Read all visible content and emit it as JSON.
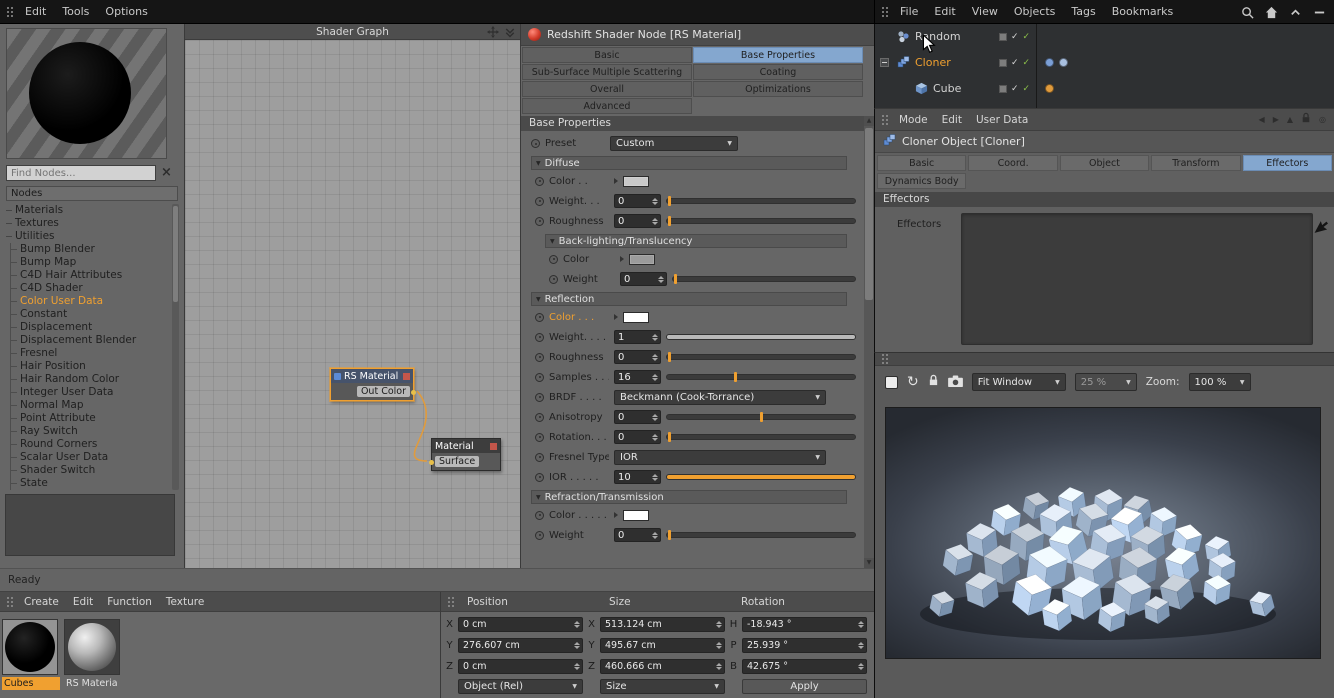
{
  "icons": {
    "check": "✓",
    "close": "×",
    "dropdown_arrow": "▼",
    "group_arrow": "▼",
    "refresh": "↻",
    "back_arrow": "◀",
    "forward_arrow": "▶",
    "up_triangle": "▲",
    "down_triangle": "▼",
    "target": "◎"
  },
  "topbar": {
    "left_menu": [
      "Edit",
      "Tools",
      "Options"
    ],
    "right_menu": [
      "File",
      "Edit",
      "View",
      "Objects",
      "Tags",
      "Bookmarks"
    ]
  },
  "node_browser": {
    "search_placeholder": "Find Nodes...",
    "header": "Nodes",
    "selected_item": "Color User Data",
    "groups": [
      {
        "label": "Materials",
        "children": []
      },
      {
        "label": "Textures",
        "children": []
      },
      {
        "label": "Utilities",
        "children": [
          "Bump Blender",
          "Bump Map",
          "C4D Hair Attributes",
          "C4D Shader",
          "Color User Data",
          "Constant",
          "Displacement",
          "Displacement Blender",
          "Fresnel",
          "Hair Position",
          "Hair Random Color",
          "Integer User Data",
          "Normal Map",
          "Point Attribute",
          "Ray Switch",
          "Round Corners",
          "Scalar User Data",
          "Shader Switch",
          "State"
        ]
      }
    ]
  },
  "shader_graph": {
    "title": "Shader Graph",
    "wire_color": "#e09b3d",
    "nodes": [
      {
        "title": "RS Material",
        "port": "Out Color"
      },
      {
        "title": "Material",
        "port": "Surface"
      }
    ]
  },
  "shader_props": {
    "title": "Redshift Shader Node [RS Material]",
    "tabs": [
      "Basic",
      "Base Properties",
      "Sub-Surface Multiple Scattering",
      "Coating",
      "Overall",
      "Optimizations",
      "Advanced",
      ""
    ],
    "active_tab": "Base Properties",
    "section": "Base Properties",
    "preset": {
      "label": "Preset",
      "value": "Custom"
    },
    "groups": [
      {
        "title": "Diffuse",
        "nested": false,
        "rows": [
          {
            "label": "Color . .",
            "type": "color",
            "swatch": "#c9c9c9"
          },
          {
            "label": "Weight. . .",
            "type": "number",
            "value": "0",
            "slider": {
              "style": "handle",
              "pos": 1
            }
          },
          {
            "label": "Roughness",
            "type": "number",
            "value": "0",
            "slider": {
              "style": "handle",
              "pos": 1
            }
          }
        ]
      },
      {
        "title": "Back-lighting/Translucency",
        "nested": true,
        "rows": [
          {
            "label": "Color",
            "type": "color",
            "swatch": "#9b9b9b"
          },
          {
            "label": "Weight",
            "type": "number",
            "value": "0",
            "slider": {
              "style": "handle",
              "pos": 1
            }
          }
        ]
      },
      {
        "title": "Reflection",
        "nested": false,
        "rows": [
          {
            "label": "Color . . .",
            "type": "color",
            "swatch": "#ffffff",
            "label_color": "#f0a030"
          },
          {
            "label": "Weight. . . .",
            "type": "number",
            "value": "1",
            "slider": {
              "style": "fill",
              "pos": 100,
              "color": "#b9b9b9"
            }
          },
          {
            "label": "Roughness",
            "type": "number",
            "value": "0",
            "slider": {
              "style": "handle",
              "pos": 1
            }
          },
          {
            "label": "Samples . . .",
            "type": "number",
            "value": "16",
            "slider": {
              "style": "handle",
              "pos": 36
            }
          },
          {
            "label": "BRDF . . . .",
            "type": "dropdown",
            "value": "Beckmann (Cook-Torrance)"
          },
          {
            "label": "Anisotropy",
            "type": "number",
            "value": "0",
            "slider": {
              "style": "handle",
              "pos": 50
            }
          },
          {
            "label": "Rotation. . .",
            "type": "number",
            "value": "0",
            "slider": {
              "style": "handle",
              "pos": 1
            }
          },
          {
            "label": "Fresnel Type",
            "type": "dropdown",
            "value": "IOR"
          },
          {
            "label": "IOR . . . . .",
            "type": "number",
            "value": "10",
            "slider": {
              "style": "fill",
              "pos": 100,
              "color": "#f0a030"
            }
          }
        ]
      },
      {
        "title": "Refraction/Transmission",
        "nested": false,
        "rows": [
          {
            "label": "Color . . . . .",
            "type": "color",
            "swatch": "#ffffff"
          },
          {
            "label": "Weight",
            "type": "number",
            "value": "0",
            "slider": {
              "style": "handle",
              "pos": 1
            }
          }
        ]
      }
    ]
  },
  "status_bar": {
    "text": "Ready"
  },
  "material_manager": {
    "menu": [
      "Create",
      "Edit",
      "Function",
      "Texture"
    ],
    "materials": [
      {
        "name": "Cubes",
        "selected": true
      },
      {
        "name": "RS Materia",
        "selected": false
      }
    ]
  },
  "coordinates": {
    "headers": [
      "Position",
      "Size",
      "Rotation"
    ],
    "columns": [
      {
        "rows": [
          {
            "axis": "X",
            "value": "0 cm"
          },
          {
            "axis": "Y",
            "value": "276.607 cm"
          },
          {
            "axis": "Z",
            "value": "0 cm"
          }
        ],
        "footer": {
          "type": "dropdown",
          "label": "Object (Rel)"
        }
      },
      {
        "rows": [
          {
            "axis": "X",
            "value": "513.124 cm"
          },
          {
            "axis": "Y",
            "value": "495.67 cm"
          },
          {
            "axis": "Z",
            "value": "460.666 cm"
          }
        ],
        "footer": {
          "type": "dropdown",
          "label": "Size"
        }
      },
      {
        "rows": [
          {
            "axis": "H",
            "value": "-18.943 °"
          },
          {
            "axis": "P",
            "value": "25.939 °"
          },
          {
            "axis": "B",
            "value": "42.675 °"
          }
        ],
        "footer": {
          "type": "button",
          "label": "Apply"
        }
      }
    ]
  },
  "object_manager": {
    "objects": [
      {
        "name": "Random",
        "indent": 0,
        "icon": "random-effector-icon",
        "expander": false,
        "selected": false,
        "tags": []
      },
      {
        "name": "Cloner",
        "indent": 0,
        "icon": "cloner-icon",
        "expander": true,
        "selected": true,
        "tags": [
          "#7b9fd6",
          "#a9c0e0"
        ]
      },
      {
        "name": "Cube",
        "indent": 1,
        "icon": "cube-icon",
        "expander": false,
        "selected": false,
        "tags": [
          "#e09b3d"
        ]
      }
    ]
  },
  "attribute_manager": {
    "menu": [
      "Mode",
      "Edit",
      "User Data"
    ],
    "title": "Cloner Object [Cloner]",
    "tabs": [
      "Basic",
      "Coord.",
      "Object",
      "Transform",
      "Effectors",
      "Dynamics Body"
    ],
    "active_tab": "Effectors",
    "section": "Effectors",
    "list_label": "Effectors"
  },
  "render_view": {
    "fit_dropdown": "Fit Window",
    "scale_dropdown": "25 %",
    "zoom_label": "Zoom:",
    "zoom_dropdown": "100 %"
  }
}
